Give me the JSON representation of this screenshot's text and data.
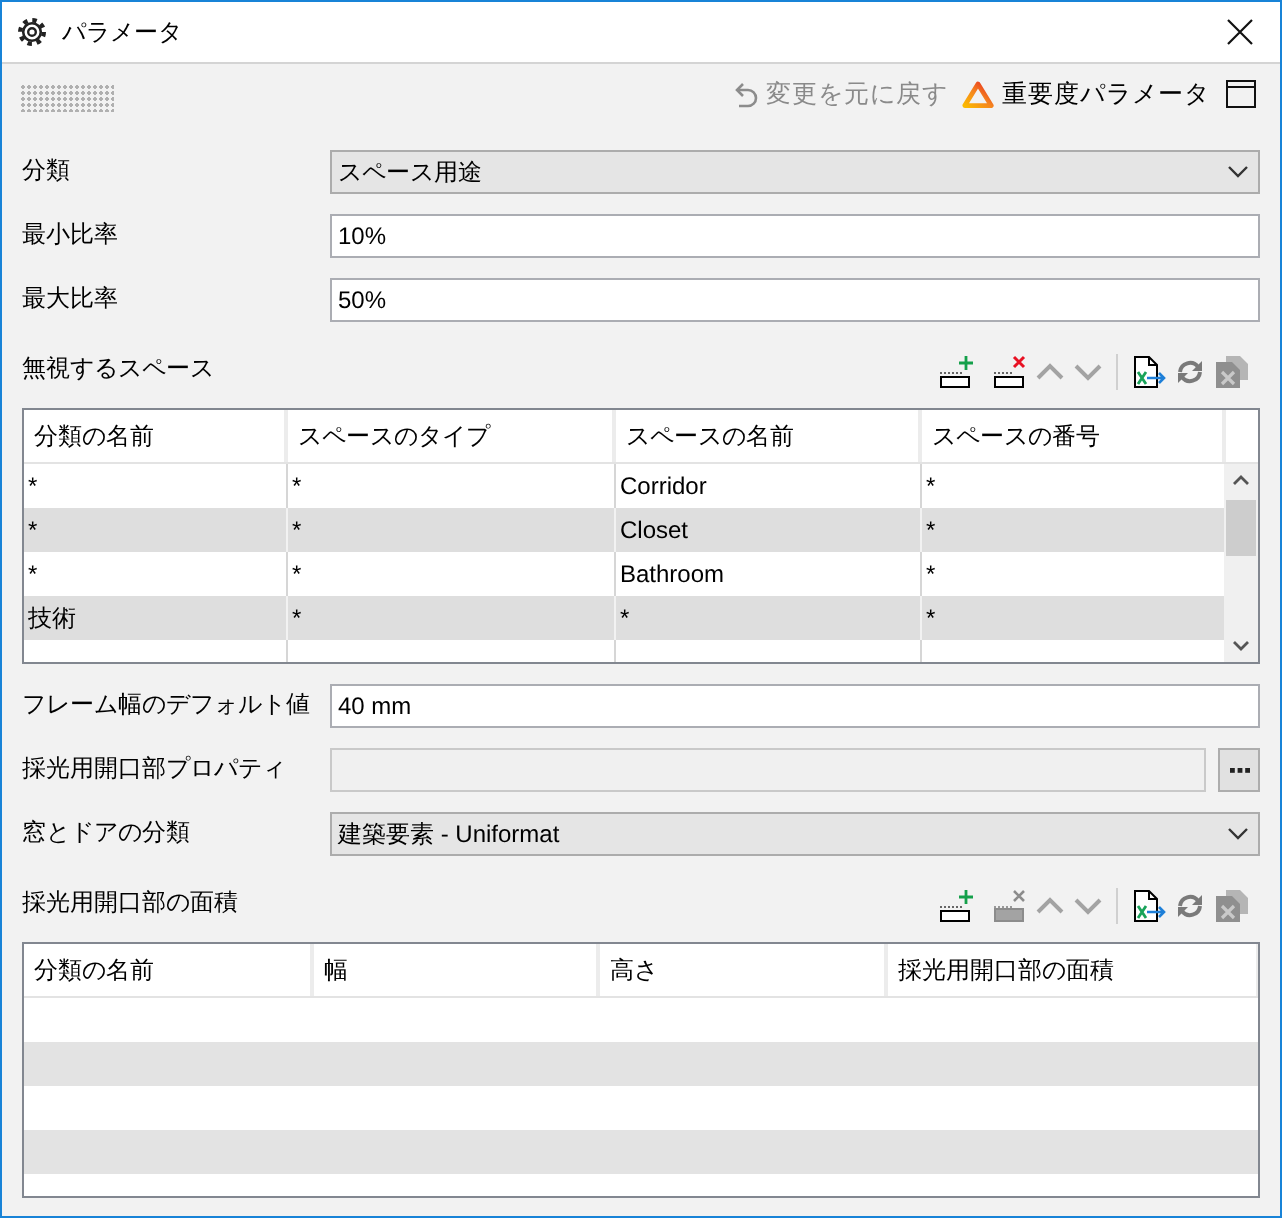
{
  "window": {
    "title": "パラメータ"
  },
  "toolbar": {
    "undo": {
      "label": "変更を元に戻す",
      "disabled": true
    },
    "severity": {
      "label": "重要度パラメータ"
    }
  },
  "form": [
    {
      "kind": "dropdown",
      "label": "分類",
      "value": "スペース用途"
    },
    {
      "kind": "text",
      "label": "最小比率",
      "value": "10%"
    },
    {
      "kind": "text",
      "label": "最大比率",
      "value": "50%"
    },
    {
      "kind": "table_section",
      "title": "無視するスペース",
      "tools": [
        {
          "kind": "add",
          "disabled": false
        },
        {
          "kind": "delete",
          "disabled": false
        },
        {
          "kind": "move_up",
          "disabled": true
        },
        {
          "kind": "move_down",
          "disabled": true
        },
        {
          "kind": "export",
          "disabled": false
        },
        {
          "kind": "refresh",
          "disabled": false
        },
        {
          "kind": "clear",
          "disabled": true
        }
      ],
      "scrollbar": true,
      "columns": [
        "分類の名前",
        "スペースのタイプ",
        "スペースの名前",
        "スペースの番号"
      ],
      "rows": [
        [
          "*",
          "*",
          "Corridor",
          "*"
        ],
        [
          "*",
          "*",
          "Closet",
          "*"
        ],
        [
          "*",
          "*",
          "Bathroom",
          "*"
        ],
        [
          "技術",
          "*",
          "*",
          "*"
        ]
      ]
    },
    {
      "kind": "text",
      "label": "フレーム幅のデフォルト値",
      "value": "40 mm"
    },
    {
      "kind": "browse",
      "label": "採光用開口部プロパティ",
      "disabled": true
    },
    {
      "kind": "dropdown",
      "label": "窓とドアの分類",
      "value": "建築要素 - Uniformat"
    },
    {
      "kind": "table_section",
      "title": "採光用開口部の面積",
      "tools": [
        {
          "kind": "add",
          "disabled": false
        },
        {
          "kind": "delete",
          "disabled": true
        },
        {
          "kind": "move_up",
          "disabled": true
        },
        {
          "kind": "move_down",
          "disabled": true
        },
        {
          "kind": "export",
          "disabled": false
        },
        {
          "kind": "refresh",
          "disabled": false
        },
        {
          "kind": "clear",
          "disabled": true
        }
      ],
      "columns": [
        "分類の名前",
        "幅",
        "高さ",
        "採光用開口部の面積"
      ]
    }
  ]
}
